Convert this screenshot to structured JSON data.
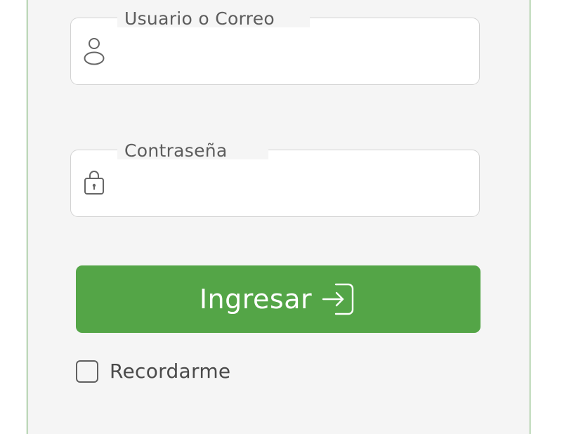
{
  "form": {
    "username": {
      "label": "Usuario o Correo",
      "value": "",
      "icon": "user-icon"
    },
    "password": {
      "label": "Contraseña",
      "value": "",
      "icon": "lock-icon"
    },
    "submit": {
      "label": "Ingresar",
      "icon": "login-icon"
    },
    "remember": {
      "label": "Recordarme",
      "checked": false
    }
  },
  "colors": {
    "accent": "#54a547",
    "panel_border": "#4e9a43",
    "panel_background": "#f5f5f5",
    "field_border": "#d3d3d3",
    "label_text": "#5d5d5d"
  }
}
